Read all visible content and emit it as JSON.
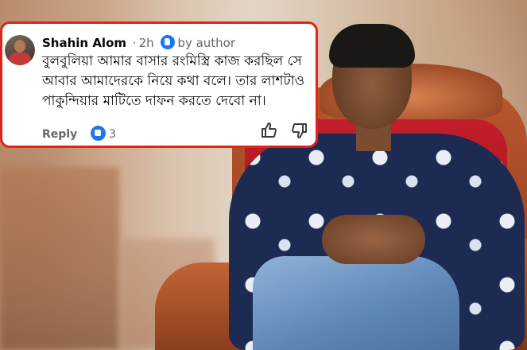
{
  "comment": {
    "author": "Shahin Alom",
    "separator": "·",
    "time": "2h",
    "author_label": "by author",
    "text": "বুলবুলিয়া আমার বাসার রংমিস্ত্রি কাজ করছিল সে আবার আমাদেরকে নিয়ে কথা বলে। তার লাশটাও পাকুন্দিয়ার মাটিতে দাফন করতে দেবো না।",
    "reply_label": "Reply",
    "reaction_count": "3",
    "reaction_icon": "like-icon",
    "colors": {
      "frame": "#e2231a",
      "accent": "#1877f2",
      "name": "#050505",
      "muted": "#65676b"
    }
  }
}
